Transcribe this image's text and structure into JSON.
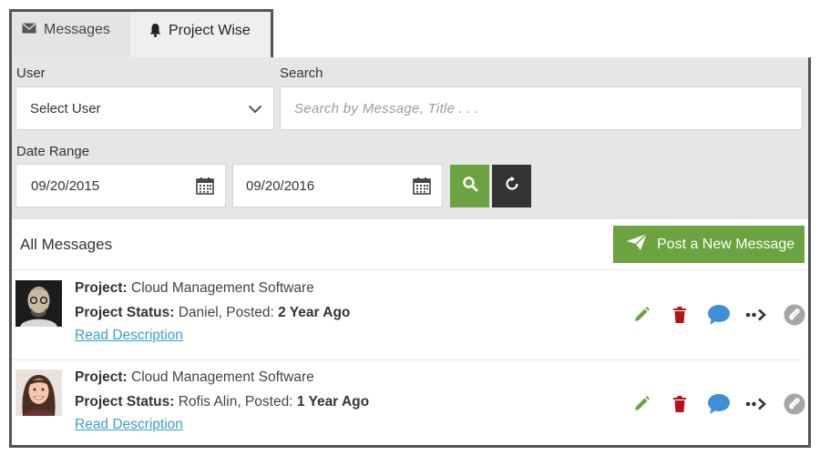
{
  "tabs": [
    {
      "label": "Messages",
      "icon": "envelope-icon",
      "active": false
    },
    {
      "label": "Project Wise",
      "icon": "bell-icon",
      "active": true
    }
  ],
  "filters": {
    "user_label": "User",
    "user_value": "Select User",
    "search_label": "Search",
    "search_placeholder": "Search by Message, Title  . . .",
    "date_label": "Date Range",
    "date_from": "09/20/2015",
    "date_to": "09/20/2016"
  },
  "list": {
    "title": "All Messages",
    "post_button": "Post a New Message"
  },
  "messages": [
    {
      "project_key": "Project:",
      "project_value": "Cloud Management Software",
      "status_key": "Project Status:",
      "status_person": "Daniel, Posted:",
      "posted_ago": "2 Year Ago",
      "read_link": "Read Description"
    },
    {
      "project_key": "Project:",
      "project_value": "Cloud Management Software",
      "status_key": "Project Status:",
      "status_person": "Rofis Alin, Posted:",
      "posted_ago": "1 Year Ago",
      "read_link": "Read Description"
    }
  ],
  "colors": {
    "accent_green": "#6aa33f",
    "dark_button": "#333333",
    "delete_red": "#b5121b",
    "comment_blue": "#3f8fd6",
    "link_blue": "#3aa0c9",
    "filter_bg": "#e6e6e6"
  }
}
